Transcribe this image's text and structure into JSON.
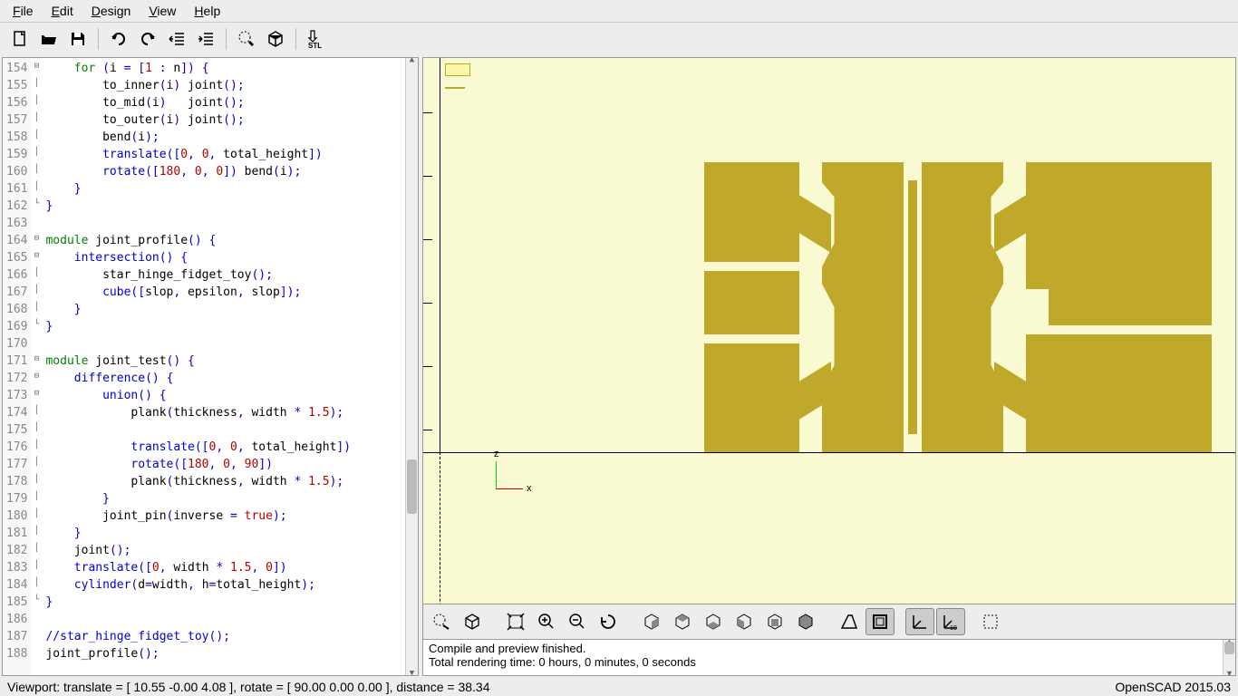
{
  "menu": {
    "file": "File",
    "edit": "Edit",
    "design": "Design",
    "view": "View",
    "help": "Help"
  },
  "code_lines": [
    {
      "n": 154,
      "fold": "⊟",
      "html": "    <span class='kw'>for</span> <span class='br'>(</span>i <span class='br'>=</span> <span class='br'>[</span><span class='num'>1</span> <span class='br'>:</span> n<span class='br'>])</span> <span class='br'>{</span>"
    },
    {
      "n": 155,
      "fold": "│",
      "html": "        to_inner<span class='br'>(</span>i<span class='br'>)</span> joint<span class='br'>();</span>"
    },
    {
      "n": 156,
      "fold": "│",
      "html": "        to_mid<span class='br'>(</span>i<span class='br'>)</span>   joint<span class='br'>();</span>"
    },
    {
      "n": 157,
      "fold": "│",
      "html": "        to_outer<span class='br'>(</span>i<span class='br'>)</span> joint<span class='br'>();</span>"
    },
    {
      "n": 158,
      "fold": "│",
      "html": "        bend<span class='br'>(</span>i<span class='br'>);</span>"
    },
    {
      "n": 159,
      "fold": "│",
      "html": "        <span class='fn'>translate</span><span class='br'>([</span><span class='num'>0</span><span class='br'>,</span> <span class='num'>0</span><span class='br'>,</span> total_height<span class='br'>])</span>"
    },
    {
      "n": 160,
      "fold": "│",
      "html": "        <span class='fn'>rotate</span><span class='br'>([</span><span class='num'>180</span><span class='br'>,</span> <span class='num'>0</span><span class='br'>,</span> <span class='num'>0</span><span class='br'>])</span> bend<span class='br'>(</span>i<span class='br'>);</span>"
    },
    {
      "n": 161,
      "fold": "│",
      "html": "    <span class='br'>}</span>"
    },
    {
      "n": 162,
      "fold": "└",
      "html": "<span class='br'>}</span>"
    },
    {
      "n": 163,
      "fold": " ",
      "html": ""
    },
    {
      "n": 164,
      "fold": "⊟",
      "html": "<span class='kw'>module</span> joint_profile<span class='br'>()</span> <span class='br'>{</span>"
    },
    {
      "n": 165,
      "fold": "⊟",
      "html": "    <span class='fn'>intersection</span><span class='br'>()</span> <span class='br'>{</span>"
    },
    {
      "n": 166,
      "fold": "│",
      "html": "        star_hinge_fidget_toy<span class='br'>();</span>"
    },
    {
      "n": 167,
      "fold": "│",
      "html": "        <span class='fn'>cube</span><span class='br'>([</span>slop<span class='br'>,</span> epsilon<span class='br'>,</span> slop<span class='br'>]);</span>"
    },
    {
      "n": 168,
      "fold": "│",
      "html": "    <span class='br'>}</span>"
    },
    {
      "n": 169,
      "fold": "└",
      "html": "<span class='br'>}</span>"
    },
    {
      "n": 170,
      "fold": " ",
      "html": ""
    },
    {
      "n": 171,
      "fold": "⊟",
      "html": "<span class='kw'>module</span> joint_test<span class='br'>()</span> <span class='br'>{</span>"
    },
    {
      "n": 172,
      "fold": "⊟",
      "html": "    <span class='fn'>difference</span><span class='br'>()</span> <span class='br'>{</span>"
    },
    {
      "n": 173,
      "fold": "⊟",
      "html": "        <span class='fn'>union</span><span class='br'>()</span> <span class='br'>{</span>"
    },
    {
      "n": 174,
      "fold": "│",
      "html": "            plank<span class='br'>(</span>thickness<span class='br'>,</span> width <span class='br'>*</span> <span class='num'>1.5</span><span class='br'>);</span>"
    },
    {
      "n": 175,
      "fold": "│",
      "html": ""
    },
    {
      "n": 176,
      "fold": "│",
      "html": "            <span class='fn'>translate</span><span class='br'>([</span><span class='num'>0</span><span class='br'>,</span> <span class='num'>0</span><span class='br'>,</span> total_height<span class='br'>])</span>"
    },
    {
      "n": 177,
      "fold": "│",
      "html": "            <span class='fn'>rotate</span><span class='br'>([</span><span class='num'>180</span><span class='br'>,</span> <span class='num'>0</span><span class='br'>,</span> <span class='num'>90</span><span class='br'>])</span>"
    },
    {
      "n": 178,
      "fold": "│",
      "html": "            plank<span class='br'>(</span>thickness<span class='br'>,</span> width <span class='br'>*</span> <span class='num'>1.5</span><span class='br'>);</span>"
    },
    {
      "n": 179,
      "fold": "│",
      "html": "        <span class='br'>}</span>"
    },
    {
      "n": 180,
      "fold": "│",
      "html": "        joint_pin<span class='br'>(</span>inverse <span class='br'>=</span> <span class='num'>true</span><span class='br'>);</span>"
    },
    {
      "n": 181,
      "fold": "│",
      "html": "    <span class='br'>}</span>"
    },
    {
      "n": 182,
      "fold": "│",
      "html": "    joint<span class='br'>();</span>"
    },
    {
      "n": 183,
      "fold": "│",
      "html": "    <span class='fn'>translate</span><span class='br'>([</span><span class='num'>0</span><span class='br'>,</span> width <span class='br'>*</span> <span class='num'>1.5</span><span class='br'>,</span> <span class='num'>0</span><span class='br'>])</span>"
    },
    {
      "n": 184,
      "fold": "│",
      "html": "    <span class='fn'>cylinder</span><span class='br'>(</span>d<span class='br'>=</span>width<span class='br'>,</span> h<span class='br'>=</span>total_height<span class='br'>);</span>"
    },
    {
      "n": 185,
      "fold": "└",
      "html": "<span class='br'>}</span>"
    },
    {
      "n": 186,
      "fold": " ",
      "html": ""
    },
    {
      "n": 187,
      "fold": " ",
      "html": "<span class='cmt'>//star_hinge_fidget_toy();</span>"
    },
    {
      "n": 188,
      "fold": " ",
      "html": "joint_profile<span class='br'>();</span>"
    }
  ],
  "console": {
    "line1": "Compile and preview finished.",
    "line2": "Total rendering time: 0 hours, 0 minutes, 0 seconds"
  },
  "status": {
    "left": "Viewport: translate = [ 10.55 -0.00 4.08 ], rotate = [ 90.00 0.00 0.00 ], distance = 38.34",
    "right": "OpenSCAD 2015.03"
  },
  "axis": {
    "z": "z",
    "x": "x"
  }
}
